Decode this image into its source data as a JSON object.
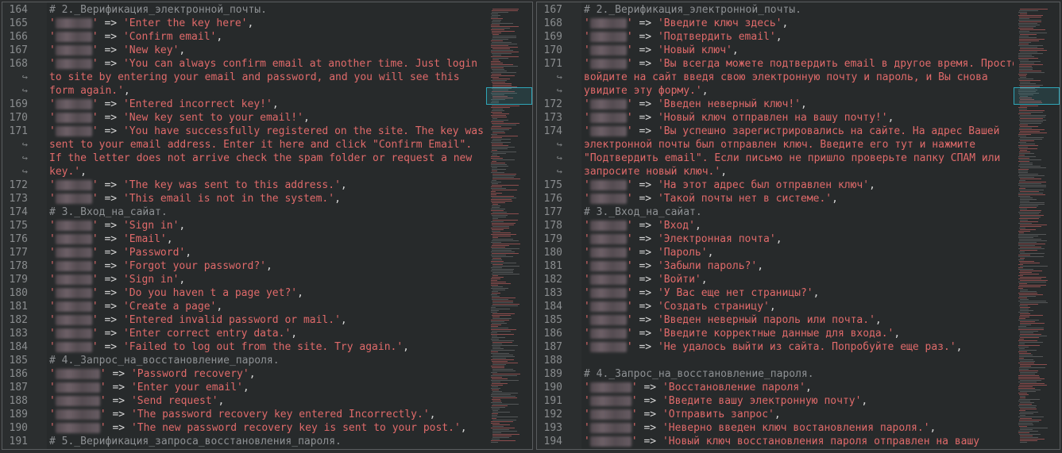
{
  "left": {
    "lines": [
      {
        "n": "164",
        "kind": "cmt",
        "text": "# 2._Верификация_электронной_почты."
      },
      {
        "n": "165",
        "kind": "kv",
        "value": "'Enter the key here'",
        "tail": ","
      },
      {
        "n": "166",
        "kind": "kv",
        "value": "'Confirm email'",
        "tail": ","
      },
      {
        "n": "167",
        "kind": "kv",
        "value": "'New key'",
        "tail": ","
      },
      {
        "n": "168",
        "kind": "kv",
        "value": "'You can always confirm email at another time. Just login",
        "tail": ""
      },
      {
        "n": "",
        "kind": "wrap",
        "text": "to site by entering your email and password, and you will see this"
      },
      {
        "n": "",
        "kind": "wrap",
        "text": "form again.'",
        "tail": ","
      },
      {
        "n": "169",
        "kind": "kv",
        "value": "'Entered incorrect key!'",
        "tail": ","
      },
      {
        "n": "170",
        "kind": "kv",
        "value": "'New key sent to your email!'",
        "tail": ","
      },
      {
        "n": "171",
        "kind": "kv",
        "value": "'You have successfully registered on the site. The key was",
        "tail": ""
      },
      {
        "n": "",
        "kind": "wrap",
        "text": "sent to your email address. Enter it here and click \"Confirm Email\"."
      },
      {
        "n": "",
        "kind": "wrap",
        "text": "If the letter does not arrive check the spam folder or request a new"
      },
      {
        "n": "",
        "kind": "wrap",
        "text": "key.'",
        "tail": ","
      },
      {
        "n": "172",
        "kind": "kv",
        "value": "'The key was sent to this address.'",
        "tail": ","
      },
      {
        "n": "173",
        "kind": "kv",
        "value": "'This email is not in the system.'",
        "tail": ","
      },
      {
        "n": "174",
        "kind": "cmt",
        "text": "# 3._Вход_на_сайат."
      },
      {
        "n": "175",
        "kind": "kv",
        "value": "'Sign in'",
        "tail": ","
      },
      {
        "n": "176",
        "kind": "kv",
        "value": "'Email'",
        "tail": ","
      },
      {
        "n": "177",
        "kind": "kv",
        "value": "'Password'",
        "tail": ","
      },
      {
        "n": "178",
        "kind": "kv",
        "value": "'Forgot your password?'",
        "tail": ","
      },
      {
        "n": "179",
        "kind": "kv",
        "value": "'Sign in'",
        "tail": ","
      },
      {
        "n": "180",
        "kind": "kv",
        "value": "'Do you haven t a page yet?'",
        "tail": ","
      },
      {
        "n": "181",
        "kind": "kv",
        "value": "'Create a page'",
        "tail": ","
      },
      {
        "n": "182",
        "kind": "kv",
        "value": "'Entered invalid password or mail.'",
        "tail": ","
      },
      {
        "n": "183",
        "kind": "kv",
        "value": "'Enter correct entry data.'",
        "tail": ","
      },
      {
        "n": "184",
        "kind": "kv",
        "value": "'Failed to log out from the site. Try again.'",
        "tail": ","
      },
      {
        "n": "185",
        "kind": "cmt",
        "text": "# 4._Запрос_на_восстановление_пароля."
      },
      {
        "n": "186",
        "kind": "kv2",
        "value": "'Password recovery'",
        "tail": ","
      },
      {
        "n": "187",
        "kind": "kv2",
        "value": "'Enter your email'",
        "tail": ","
      },
      {
        "n": "188",
        "kind": "kv2",
        "value": "'Send request'",
        "tail": ","
      },
      {
        "n": "189",
        "kind": "kv2",
        "value": "'The password recovery key entered Incorrectly.'",
        "tail": ","
      },
      {
        "n": "190",
        "kind": "kv2",
        "value": "'The new password recovery key is sent to your post.'",
        "tail": ","
      },
      {
        "n": "191",
        "kind": "cmt",
        "text": "# 5._Верификация_запроса_восстановления_пароля."
      }
    ]
  },
  "right": {
    "lines": [
      {
        "n": "167",
        "kind": "cmt",
        "text": "# 2._Верификация_электронной_почты."
      },
      {
        "n": "168",
        "kind": "kv",
        "value": "'Введите ключ здесь'",
        "tail": ","
      },
      {
        "n": "169",
        "kind": "kv",
        "value": "'Подтвердить email'",
        "tail": ","
      },
      {
        "n": "170",
        "kind": "kv",
        "value": "'Новый ключ'",
        "tail": ","
      },
      {
        "n": "171",
        "kind": "kv",
        "value": "'Вы всегда можете подтвердить email в другое время. Просто",
        "tail": ""
      },
      {
        "n": "",
        "kind": "wrap",
        "text": "войдите на сайт введя свою электронную почту и пароль, и Вы снова"
      },
      {
        "n": "",
        "kind": "wrap",
        "text": "увидите эту форму.'",
        "tail": ","
      },
      {
        "n": "172",
        "kind": "kv",
        "value": "'Введен неверный ключ!'",
        "tail": ","
      },
      {
        "n": "173",
        "kind": "kv",
        "value": "'Новый ключ отправлен на вашу почту!'",
        "tail": ","
      },
      {
        "n": "174",
        "kind": "kv",
        "value": "'Вы успешно зарегистрировались на сайте. На адрес Вашей",
        "tail": ""
      },
      {
        "n": "",
        "kind": "wrap",
        "text": "электронной почты был отправлен ключ. Введите его тут и нажмите"
      },
      {
        "n": "",
        "kind": "wrap",
        "text": "\"Подтвердить email\". Если письмо не пришло проверьте папку СПАМ или"
      },
      {
        "n": "",
        "kind": "wrap",
        "text": "запросите новый ключ.'",
        "tail": ","
      },
      {
        "n": "175",
        "kind": "kv",
        "value": "'На этот адрес был отправлен ключ'",
        "tail": ","
      },
      {
        "n": "176",
        "kind": "kv",
        "value": "'Такой почты нет в системе.'",
        "tail": ","
      },
      {
        "n": "177",
        "kind": "cmt",
        "text": "# 3._Вход_на_сайат."
      },
      {
        "n": "178",
        "kind": "kv",
        "value": "'Вход'",
        "tail": ","
      },
      {
        "n": "179",
        "kind": "kv",
        "value": "'Электронная почта'",
        "tail": ","
      },
      {
        "n": "180",
        "kind": "kv",
        "value": "'Пароль'",
        "tail": ","
      },
      {
        "n": "181",
        "kind": "kv",
        "value": "'Забыли пароль?'",
        "tail": ","
      },
      {
        "n": "182",
        "kind": "kv",
        "value": "'Войти'",
        "tail": ","
      },
      {
        "n": "183",
        "kind": "kv",
        "value": "'У Вас еще нет страницы?'",
        "tail": ","
      },
      {
        "n": "184",
        "kind": "kv",
        "value": "'Создать страницу'",
        "tail": ","
      },
      {
        "n": "185",
        "kind": "kv",
        "value": "'Введен неверный пароль или почта.'",
        "tail": ","
      },
      {
        "n": "186",
        "kind": "kv",
        "value": "'Введите корректные данные для входа.'",
        "tail": ","
      },
      {
        "n": "187",
        "kind": "kv",
        "value": "'Не удалось выйти из сайта. Попробуйте еще раз.'",
        "tail": ","
      },
      {
        "n": "188",
        "kind": "blank"
      },
      {
        "n": "189",
        "kind": "cmt",
        "text": "# 4._Запрос_на_восстановление_пароля."
      },
      {
        "n": "190",
        "kind": "kv2",
        "value": "'Восстановление пароля'",
        "tail": ","
      },
      {
        "n": "191",
        "kind": "kv2",
        "value": "'Введите вашу электронную почту'",
        "tail": ","
      },
      {
        "n": "192",
        "kind": "kv2",
        "value": "'Отправить запрос'",
        "tail": ","
      },
      {
        "n": "193",
        "kind": "kv2",
        "value": "'Неверно введен ключ востановления пароля.'",
        "tail": ","
      },
      {
        "n": "194",
        "kind": "kv2",
        "value": "'Новый ключ восстановления пароля отправлен на вашу",
        "tail": ""
      }
    ]
  },
  "arrow": "=>",
  "wrap_glyph": "↪",
  "quote": "'",
  "colors": {
    "string": "#e06a6a",
    "comment": "#8e9194",
    "accent": "#2fa6b8"
  }
}
